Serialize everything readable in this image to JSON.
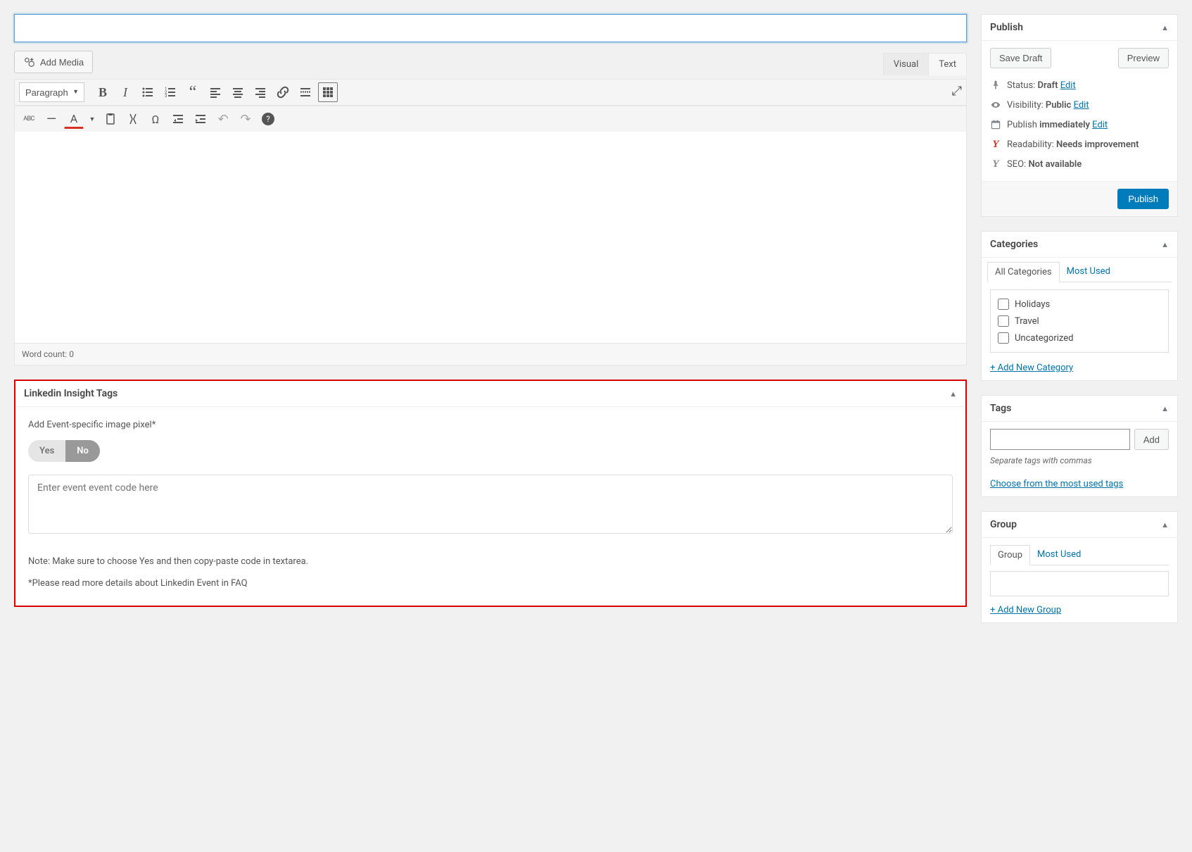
{
  "title_input": {
    "value": ""
  },
  "add_media_label": "Add Media",
  "editor": {
    "visual_tab": "Visual",
    "text_tab": "Text",
    "format_select": "Paragraph",
    "toolbar_names": [
      "bold",
      "italic",
      "ul",
      "ol",
      "quote",
      "align-left",
      "align-center",
      "align-right",
      "link",
      "more",
      "toolbar-toggle"
    ],
    "toolbar2_names": [
      "strikethrough",
      "hr",
      "text-color",
      "text-color-picker",
      "paste",
      "clear",
      "special-char",
      "outdent",
      "indent",
      "undo",
      "redo",
      "help"
    ],
    "word_count_label": "Word count: ",
    "word_count_value": "0"
  },
  "linkedin_box": {
    "title": "Linkedin Insight Tags",
    "field_label": "Add Event-specific image pixel*",
    "yes": "Yes",
    "no": "No",
    "textarea_placeholder": "Enter event event code here",
    "note": "Note: Make sure to choose Yes and then copy-paste code in textarea.",
    "note2": "*Please read more details about Linkedin Event in FAQ"
  },
  "publish": {
    "title": "Publish",
    "save_draft": "Save Draft",
    "preview": "Preview",
    "status_label": "Status: ",
    "status_value": "Draft",
    "visibility_label": "Visibility: ",
    "visibility_value": "Public",
    "schedule_label": "Publish ",
    "schedule_value": "immediately",
    "readability_label": "Readability: ",
    "readability_value": "Needs improvement",
    "seo_label": "SEO: ",
    "seo_value": "Not available",
    "edit": "Edit",
    "publish_btn": "Publish"
  },
  "categories": {
    "title": "Categories",
    "tab_all": "All Categories",
    "tab_most": "Most Used",
    "items": [
      "Holidays",
      "Travel",
      "Uncategorized"
    ],
    "add_new": "+ Add New Category"
  },
  "tags": {
    "title": "Tags",
    "add_btn": "Add",
    "hint": "Separate tags with commas",
    "choose_link": "Choose from the most used tags"
  },
  "group": {
    "title": "Group",
    "tab_group": "Group",
    "tab_most": "Most Used",
    "add_new": "+ Add New Group"
  }
}
